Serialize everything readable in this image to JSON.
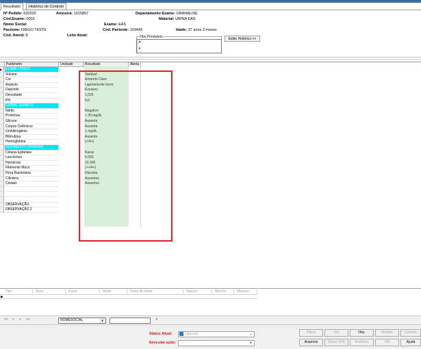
{
  "tabs": [
    "Resultado",
    "Histórico de Controle"
  ],
  "header": {
    "pedido_label": "Nº Pedido:",
    "pedido": "620320",
    "amostra_label": "Amostra:",
    "amostra": "1015867",
    "depto_label": "Departamento Exame:",
    "depto": "URANALISE",
    "cod_exame_label": "Cód.Exame:",
    "cod_exame": "0003",
    "material_label": "Material:",
    "material": "URINA EAS",
    "nome_social_label": "Nome Social:",
    "exame_label": "Exame:",
    "exame": "EAS",
    "paciente_label": "Paciente:",
    "paciente": "DIEGO TESTE",
    "cod_paciente_label": "Cód. Paciente:",
    "cod_paciente": "103443",
    "idade_label": "Idade:",
    "idade": "27 anos 3 meses",
    "atend_label": "Cód. Atend:",
    "atend": "8",
    "leito_label": "Leito Atual:",
    "obs_label": "Obs.Prontuário",
    "historico_button": "Exibe Histórico >>"
  },
  "grid": {
    "columns": [
      "Parâmetro",
      "Unidade",
      "Resultado",
      "Alerta"
    ],
    "rows": [
      {
        "param": "EXAME FÍSICO",
        "result": "",
        "section": true
      },
      {
        "param": "Volume",
        "result": "Variável"
      },
      {
        "param": "Cor",
        "result": "Amarelo Claro"
      },
      {
        "param": "Aspecto",
        "result": "Ligeiramente turvo"
      },
      {
        "param": "Depósito",
        "result": "Escasso"
      },
      {
        "param": "Densidade",
        "result": "1,025"
      },
      {
        "param": "PH",
        "result": "6,0"
      },
      {
        "param": "EXAME QUÍMICO",
        "result": "",
        "section": true
      },
      {
        "param": "Nitrito",
        "result": "Negativo"
      },
      {
        "param": "Proteínas",
        "result": "< 30 mg/dL"
      },
      {
        "param": "Glicose",
        "result": "Ausente"
      },
      {
        "param": "Corpos Cetônicos",
        "result": "Ausente"
      },
      {
        "param": "Urobilinogênio",
        "result": "1 mg/dL"
      },
      {
        "param": "Bilirrubina",
        "result": "Ausente"
      },
      {
        "param": "Hemoglobina",
        "result": "(+/4+)"
      },
      {
        "param": "SEDIMENTO URINÁRIO",
        "result": "",
        "section": true
      },
      {
        "param": "Células Epiteliais",
        "result": "Raras"
      },
      {
        "param": "Leucócitos",
        "result": "5.000"
      },
      {
        "param": "Hemácias",
        "result": "12.000"
      },
      {
        "param": "Filamento Muco",
        "result": "(++/4+)"
      },
      {
        "param": "Flora Bacteriana",
        "result": "Discreta"
      },
      {
        "param": "Cilindros",
        "result": "Ausentes"
      },
      {
        "param": "Cristais",
        "result": "Ausentes"
      },
      {
        "param": "",
        "result": ""
      },
      {
        "param": "",
        "result": ""
      },
      {
        "param": "",
        "result": ""
      },
      {
        "param": "OBSERVAÇÃO",
        "result": ""
      },
      {
        "param": "OBSERVAÇÃO 2",
        "result": ""
      }
    ]
  },
  "lower_grid": {
    "columns": [
      "Tipo",
      "Sexo",
      "Faixa",
      "Idade",
      "Faixa de idade",
      "Valores",
      "Mínimo",
      "Máximo"
    ]
  },
  "navbar": {
    "nav": [
      "<<",
      "<",
      ">",
      ">>"
    ],
    "field_select": "NOMESOCIAL",
    "search_value": ""
  },
  "bottom": {
    "status_label": "Status Atual:",
    "status_value": "Liberado",
    "acao_label": "Executar ação:",
    "acao_value": "",
    "buttons_row1": [
      "Filtros",
      "Info",
      "Obs.",
      "Modelo",
      "Concluir"
    ],
    "buttons_row2": [
      "Arquivos",
      "Salvar (F4)",
      "Desfazer",
      "OK",
      "Ajuda"
    ]
  }
}
